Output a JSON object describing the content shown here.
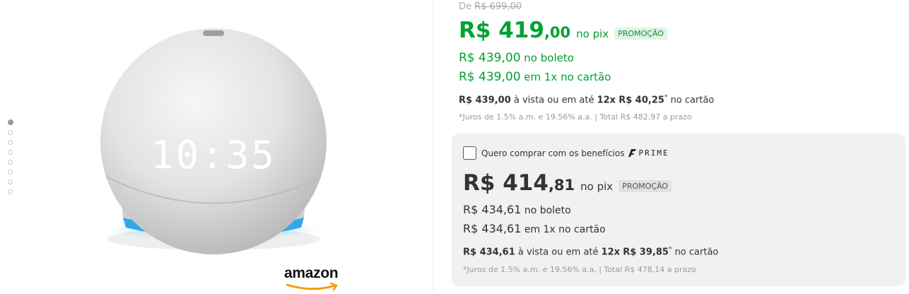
{
  "gallery": {
    "dots_count": 8,
    "active_index": 0,
    "clock_text": "10:35",
    "brand": "amazon"
  },
  "pricing": {
    "old_price_prefix": "De",
    "old_price": "R$ 699,00",
    "pix_price_int": "R$ 419",
    "pix_price_cents": ",00",
    "pix_label": "no pix",
    "promo_badge": "PROMOÇÃO",
    "boleto_price": "R$ 439,00",
    "boleto_label": "no boleto",
    "card_price": "R$ 439,00",
    "card_label": "em 1x no cartão",
    "installment": {
      "total": "R$ 439,00",
      "text1": "à vista ou em até",
      "count": "12x",
      "value": "R$ 40,25",
      "asterisk": "*",
      "text2": "no cartão"
    },
    "interest_note": "*Juros de 1.5% a.m. e 19.56% a.a. | Total R$ 482,97 a prazo"
  },
  "prime": {
    "checkbox_label": "Quero comprar com os benefícios",
    "prime_text": "PRIME",
    "checked": false,
    "pix_price_int": "R$ 414",
    "pix_price_cents": ",81",
    "pix_label": "no pix",
    "promo_badge": "PROMOÇÃO",
    "boleto_price": "R$ 434,61",
    "boleto_label": "no boleto",
    "card_price": "R$ 434,61",
    "card_label": "em 1x no cartão",
    "installment": {
      "total": "R$ 434,61",
      "text1": "à vista ou em até",
      "count": "12x",
      "value": "R$ 39,85",
      "asterisk": "*",
      "text2": "no cartão"
    },
    "interest_note": "*Juros de 1.5% a.m. e 19.56% a.a. | Total R$ 478,14 a prazo"
  }
}
